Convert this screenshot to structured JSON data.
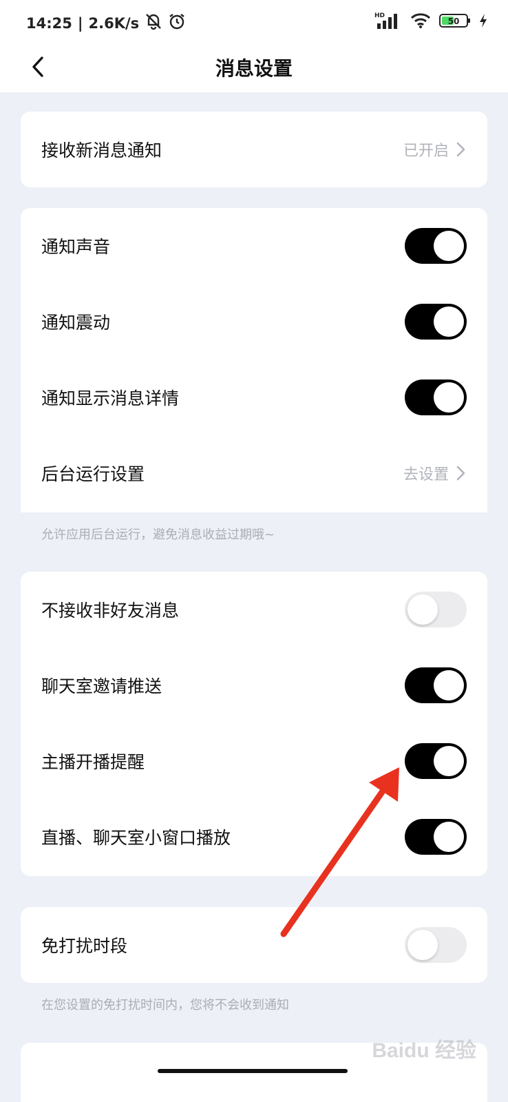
{
  "status_bar": {
    "time": "14:25",
    "speed": "2.6K/s",
    "icons": [
      "bell-muted-icon",
      "alarm-icon",
      "hd-signal-icon",
      "wifi-icon",
      "battery-icon",
      "charging-icon"
    ],
    "hd": "HD",
    "battery": "50"
  },
  "nav": {
    "title": "消息设置",
    "back_icon": "chevron-left-icon"
  },
  "section1": {
    "receive_new": {
      "label": "接收新消息通知",
      "value": "已开启"
    }
  },
  "section2": {
    "rows": [
      {
        "label": "通知声音",
        "on": true
      },
      {
        "label": "通知震动",
        "on": true
      },
      {
        "label": "通知显示消息详情",
        "on": true
      }
    ],
    "background_run": {
      "label": "后台运行设置",
      "value": "去设置"
    },
    "hint": "允许应用后台运行，避免消息收益过期哦~"
  },
  "section3": {
    "rows": [
      {
        "label": "不接收非好友消息",
        "on": false
      },
      {
        "label": "聊天室邀请推送",
        "on": true
      },
      {
        "label": "主播开播提醒",
        "on": true
      },
      {
        "label": "直播、聊天室小窗口播放",
        "on": true
      }
    ]
  },
  "section4": {
    "dnd": {
      "label": "免打扰时段",
      "on": false
    },
    "hint": "在您设置的免打扰时间内，您将不会收到通知"
  },
  "watermark": "Baidu 经验",
  "colors": {
    "background": "#eef0f7",
    "toggle_on": "#000000",
    "toggle_off": "#ececee",
    "arrow": "#e8321f",
    "secondary_text": "#b1b3ba"
  }
}
